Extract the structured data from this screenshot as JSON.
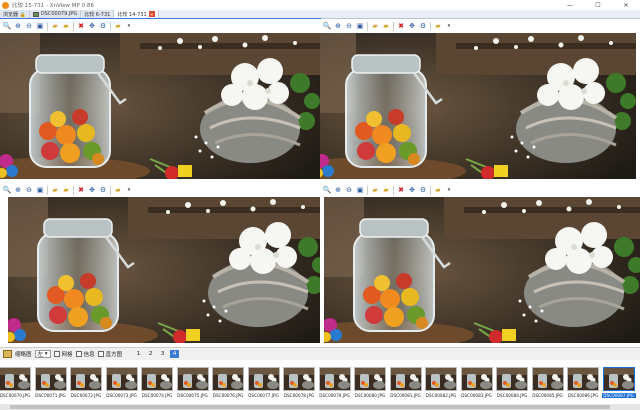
{
  "window": {
    "title": "比较 15-731 - XnView MP 0.88",
    "controls": [
      "—",
      "☐",
      "✕"
    ]
  },
  "tabs": [
    {
      "label": "浏览器 🔒",
      "active": false,
      "has_icon": false
    },
    {
      "label": "DSC00079.JPG",
      "active": false,
      "has_icon": true
    },
    {
      "label": "比较 6-731",
      "active": false,
      "has_icon": false
    },
    {
      "label": "比较 14-731",
      "active": true,
      "has_icon": false
    }
  ],
  "panel_toolbar_icons": [
    "zoom-fit-icon",
    "zoom-in-icon",
    "zoom-out-icon",
    "fit-window-icon",
    "open-folder-icon",
    "open-folder-alt-icon",
    "delete-icon",
    "move-icon",
    "settings-icon",
    "folder-dropdown-icon"
  ],
  "bottom": {
    "view_label": "缩略图",
    "view_select": "左",
    "checks": [
      "网格",
      "信息",
      "直方图"
    ],
    "pages": [
      "1",
      "2",
      "3",
      "4"
    ],
    "active_page": "4"
  },
  "filmstrip": [
    "DSC00070.JPG",
    "DSC00071.JPG",
    "DSC00072.JPG",
    "DSC00073.JPG",
    "DSC00074.JPG",
    "DSC00075.JPG",
    "DSC00076.JPG",
    "DSC00077.JPG",
    "DSC00078.JPG",
    "DSC00079.JPG",
    "DSC00080.JPG",
    "DSC00081.JPG",
    "DSC00082.JPG",
    "DSC00083.JPG",
    "DSC00084.JPG",
    "DSC00085.JPG",
    "DSC00086.JPG",
    "DSC00087.JPG"
  ],
  "selected_thumb": "DSC00087.JPG",
  "colors": {
    "accent": "#3a7bd5",
    "tab_bg": "#e9eef5",
    "bottom_bg": "#f0f0f0"
  }
}
